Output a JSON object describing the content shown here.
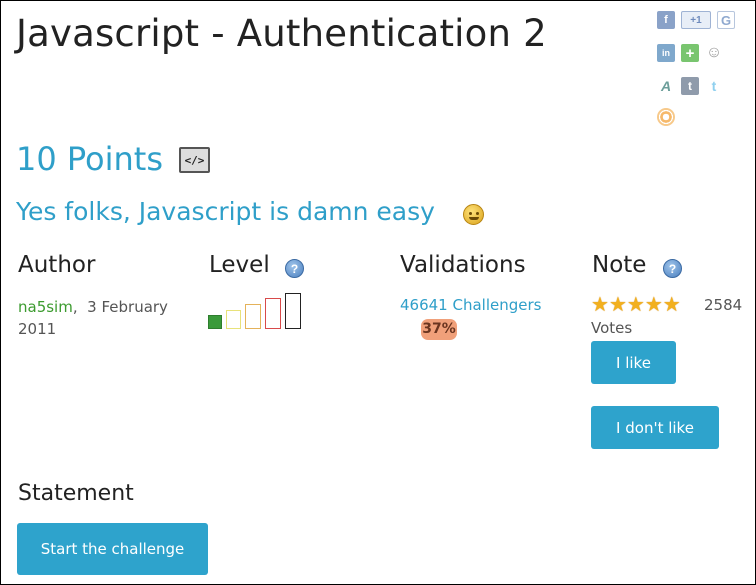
{
  "page": {
    "title": "Javascript - Authentication 2",
    "points": "10 Points",
    "subtitle": "Yes folks, Javascript is damn easy"
  },
  "social": [
    {
      "icon": "facebook-icon",
      "glyph": "f"
    },
    {
      "icon": "google-plus-one-icon",
      "glyph": "+1"
    },
    {
      "icon": "google-icon",
      "glyph": "G"
    },
    {
      "icon": "linkedin-icon",
      "glyph": "in"
    },
    {
      "icon": "add-plus-icon",
      "glyph": "+"
    },
    {
      "icon": "reddit-icon",
      "glyph": "☺"
    },
    {
      "icon": "aa-icon",
      "glyph": "A"
    },
    {
      "icon": "tumblr-icon",
      "glyph": "t"
    },
    {
      "icon": "twitter-icon",
      "glyph": "t"
    },
    {
      "icon": "share-icon",
      "glyph": ""
    }
  ],
  "columns": {
    "author": {
      "heading": "Author",
      "name": "na5sim",
      "date": "3 February 2011"
    },
    "level": {
      "heading": "Level",
      "value": 1,
      "max": 5
    },
    "validations": {
      "heading": "Validations",
      "challengers": "46641 Challengers",
      "percent": "37%"
    },
    "note": {
      "heading": "Note",
      "stars": 5,
      "votes_count": "2584",
      "votes_label": "Votes",
      "like_label": "I like",
      "dislike_label": "I don't like"
    }
  },
  "statement": {
    "heading": "Statement",
    "start_label": "Start the challenge"
  },
  "colors": {
    "accent": "#2ea3cc",
    "link": "#2f9fc9",
    "author": "#3c9b2f",
    "badge": "#f0a07a"
  }
}
